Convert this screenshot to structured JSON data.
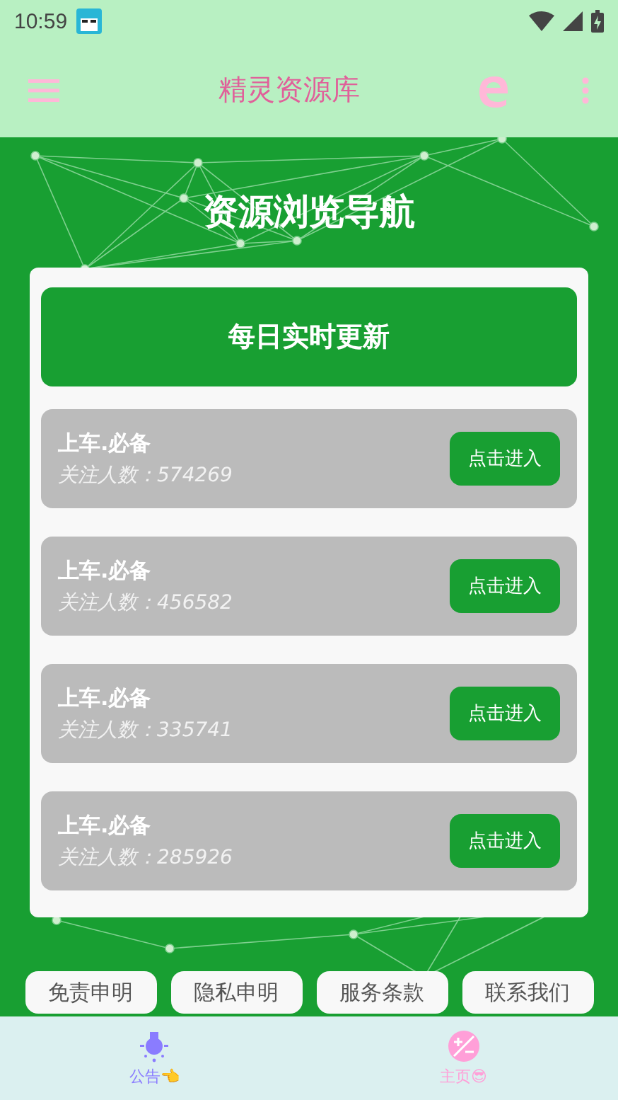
{
  "status_bar": {
    "time": "10:59"
  },
  "app_bar": {
    "title": "精灵资源库"
  },
  "heading": "资源浏览导航",
  "banner": "每日实时更新",
  "resources": [
    {
      "name": "上车.必备",
      "followers": "关注人数：574269",
      "action": "点击进入"
    },
    {
      "name": "上车.必备",
      "followers": "关注人数：456582",
      "action": "点击进入"
    },
    {
      "name": "上车.必备",
      "followers": "关注人数：335741",
      "action": "点击进入"
    },
    {
      "name": "上车.必备",
      "followers": "关注人数：285926",
      "action": "点击进入"
    }
  ],
  "footer_links": [
    "免责申明",
    "隐私申明",
    "服务条款",
    "联系我们"
  ],
  "bottom_nav": [
    {
      "label": "公告👈",
      "kind": "bulb",
      "color": "#8a7cff"
    },
    {
      "label": "主页😎",
      "kind": "plusminus",
      "color": "#ff9fd8"
    }
  ]
}
